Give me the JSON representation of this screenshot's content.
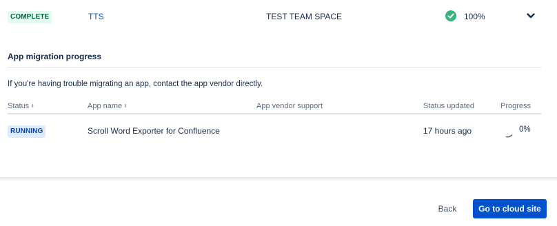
{
  "space_row": {
    "status": "COMPLETE",
    "key": "TTS",
    "name": "TEST TEAM SPACE",
    "progress": "100%"
  },
  "app_migration": {
    "title": "App migration progress",
    "help_text": "If you're having trouble migrating an app, contact the app vendor directly.",
    "columns": {
      "status": "Status",
      "app_name": "App name",
      "vendor_support": "App vendor support",
      "status_updated": "Status updated",
      "progress": "Progress"
    },
    "rows": [
      {
        "status": "RUNNING",
        "app_name": "Scroll Word Exporter for Confluence",
        "vendor_support": "",
        "status_updated": "17 hours ago",
        "progress": "0%"
      }
    ]
  },
  "footer": {
    "back_label": "Back",
    "primary_label": "Go to cloud site"
  },
  "colors": {
    "brand_blue": "#0052cc",
    "complete_bg": "#e3fcef",
    "complete_text": "#006644",
    "running_bg": "#deebff",
    "running_text": "#0747a6",
    "success_green": "#36b37e"
  },
  "icons": [
    "check-circle-icon",
    "chevron-down-icon",
    "sort-icon",
    "spinner-icon"
  ]
}
